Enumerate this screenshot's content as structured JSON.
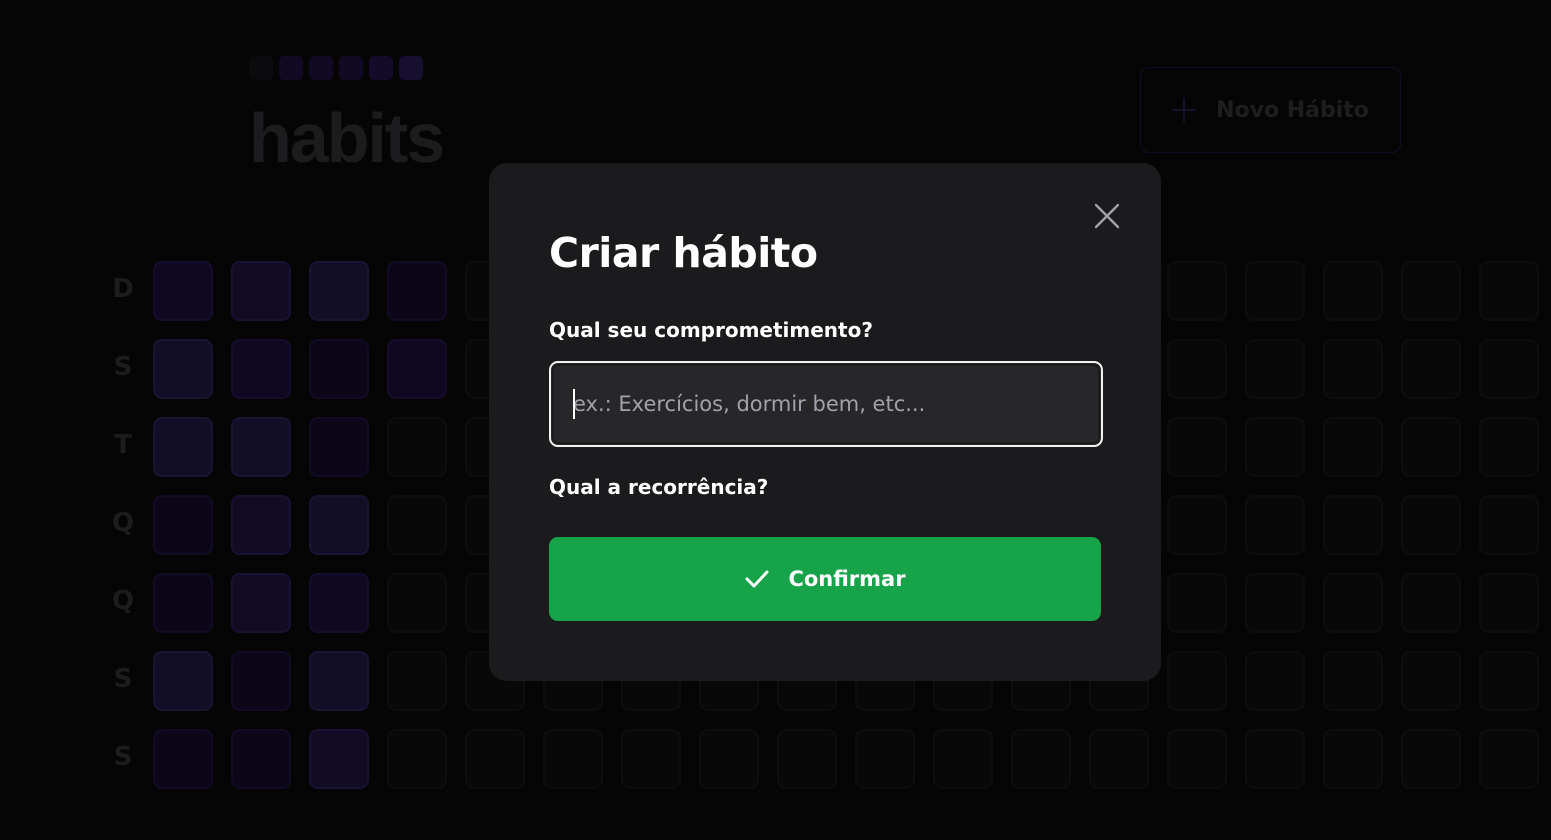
{
  "app": {
    "logo_text": "habits",
    "logo_square_colors": [
      "#121214",
      "#1c0f3a",
      "#1c0f3a",
      "#1c0f3a",
      "#1e1240",
      "#22184a"
    ],
    "new_habit_button_label": "Novo Hábito",
    "new_habit_icon": "plus-icon"
  },
  "summary": {
    "weekdays": [
      "D",
      "S",
      "T",
      "Q",
      "Q",
      "S",
      "S"
    ],
    "filled_levels_by_column": [
      [
        2,
        4,
        4,
        1,
        1,
        4,
        1
      ],
      [
        3,
        2,
        4,
        3,
        3,
        1,
        1
      ],
      [
        4,
        1,
        1,
        4,
        2,
        4,
        3
      ],
      [
        1,
        2
      ]
    ]
  },
  "modal": {
    "title": "Criar hábito",
    "close_icon": "close-icon",
    "commitment_label": "Qual seu comprometimento?",
    "commitment_input": {
      "value": "",
      "placeholder": "ex.: Exercícios, dormir bem, etc..."
    },
    "recurrence_label": "Qual a recorrência?",
    "confirm_button_label": "Confirmar",
    "confirm_icon": "check-icon",
    "confirm_color": "#16a34a"
  }
}
